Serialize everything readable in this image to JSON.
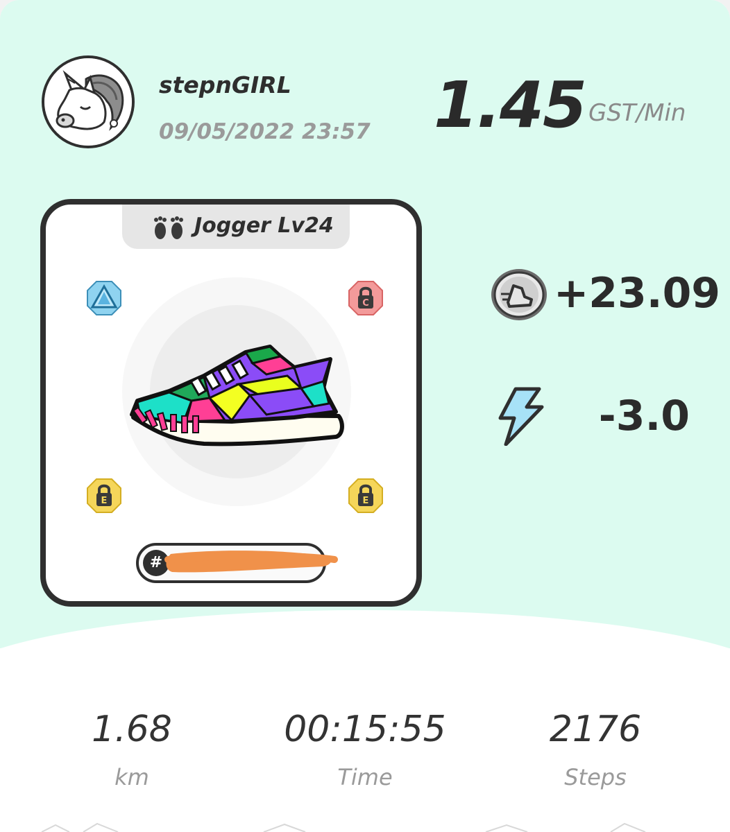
{
  "profile": {
    "username": "stepnGIRL",
    "timestamp": "09/05/2022 23:57",
    "avatar_icon": "unicorn-icon"
  },
  "earning_rate": {
    "value": "1.45",
    "unit": "GST/Min"
  },
  "sneaker": {
    "type_label": "Jogger Lv24",
    "type_icon": "footprints-icon",
    "id_prefix": "#",
    "sockets": [
      {
        "icon": "gem-socket-icon",
        "color": "#7cc8ea"
      },
      {
        "icon": "locked-socket-icon",
        "letter": "C",
        "color": "#f08a8a"
      },
      {
        "icon": "locked-socket-icon",
        "letter": "E",
        "color": "#f2cf4a"
      },
      {
        "icon": "locked-socket-icon",
        "letter": "E",
        "color": "#f2cf4a"
      }
    ]
  },
  "rewards": {
    "gst_earned": "+23.09",
    "gst_icon": "gst-coin-icon",
    "energy_change": "-3.0",
    "energy_icon": "lightning-icon"
  },
  "stats": [
    {
      "value": "1.68",
      "label": "km"
    },
    {
      "value": "00:15:55",
      "label": "Time"
    },
    {
      "value": "2176",
      "label": "Steps"
    }
  ],
  "colors": {
    "background_mint": "#dcfbf0",
    "card_border": "#2f2f2f",
    "redaction": "#f0914a"
  }
}
